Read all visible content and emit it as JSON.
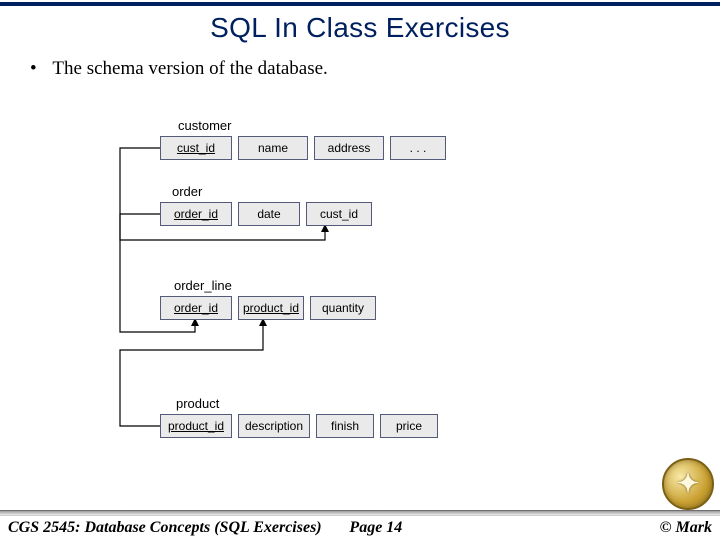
{
  "title": "SQL In Class Exercises",
  "bullet_text": "The schema version of the database.",
  "tables": {
    "customer": {
      "label": "customer",
      "fields": {
        "f0": "cust_id",
        "f1": "name",
        "f2": "address",
        "f3": ". . ."
      }
    },
    "order": {
      "label": "order",
      "fields": {
        "f0": "order_id",
        "f1": "date",
        "f2": "cust_id"
      }
    },
    "order_line": {
      "label": "order_line",
      "fields": {
        "f0": "order_id",
        "f1": "product_id",
        "f2": "quantity"
      }
    },
    "product": {
      "label": "product",
      "fields": {
        "f0": "product_id",
        "f1": "description",
        "f2": "finish",
        "f3": "price"
      }
    }
  },
  "footer": {
    "left": "CGS 2545: Database Concepts  (SQL Exercises)",
    "mid": "Page 14",
    "right": "© Mark"
  },
  "seal_glyph": "✦"
}
